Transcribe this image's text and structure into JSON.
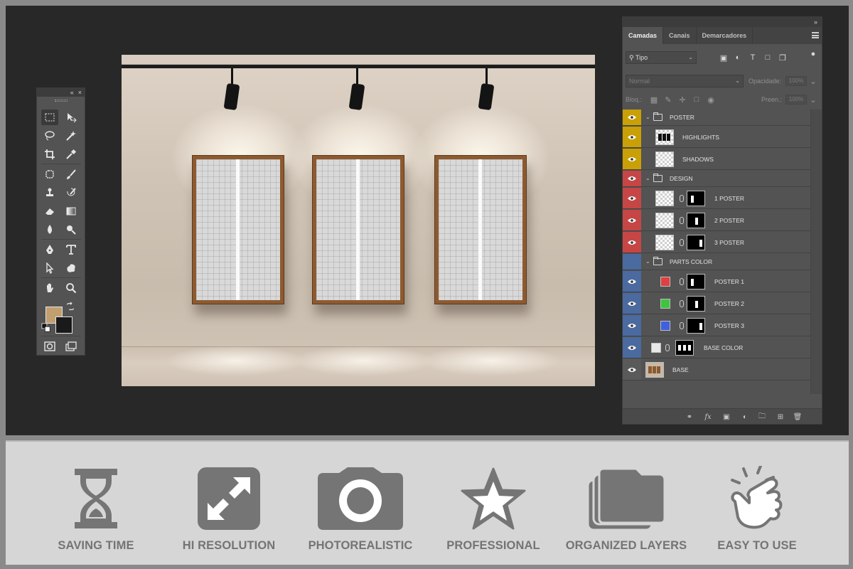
{
  "layers_panel": {
    "tabs": [
      {
        "label": "Camadas",
        "active": true
      },
      {
        "label": "Canais",
        "active": false
      },
      {
        "label": "Demarcadores",
        "active": false
      }
    ],
    "filter_label": "Tipo",
    "blend_mode": "Normal",
    "opacity_label": "Opacidade:",
    "opacity_value": "100%",
    "lock_label": "Bloq.:",
    "fill_label": "Preen.:",
    "fill_value": "100%",
    "layers": [
      {
        "name": "POSTER",
        "type": "group",
        "tag_color": "#c9a005"
      },
      {
        "name": "HIGHLIGHTS",
        "type": "layer",
        "tag_color": "#c9a005"
      },
      {
        "name": "SHADOWS",
        "type": "layer",
        "tag_color": "#c9a005"
      },
      {
        "name": "DESIGN",
        "type": "group",
        "tag_color": "#c64646"
      },
      {
        "name": "1 POSTER",
        "type": "smart",
        "tag_color": "#c64646"
      },
      {
        "name": "2 POSTER",
        "type": "smart",
        "tag_color": "#c64646"
      },
      {
        "name": "3 POSTER",
        "type": "smart",
        "tag_color": "#c64646"
      },
      {
        "name": "PARTS COLOR",
        "type": "group",
        "tag_color": "#4a6aa0"
      },
      {
        "name": "POSTER 1",
        "type": "fill",
        "tag_color": "#4a6aa0",
        "swatch": "#e04040"
      },
      {
        "name": "POSTER 2",
        "type": "fill",
        "tag_color": "#4a6aa0",
        "swatch": "#3fc43f"
      },
      {
        "name": "POSTER 3",
        "type": "fill",
        "tag_color": "#4a6aa0",
        "swatch": "#4060e0"
      },
      {
        "name": "BASE COLOR",
        "type": "fill",
        "tag_color": "#4a6aa0",
        "swatch": "#e8e8e8"
      },
      {
        "name": "BASE",
        "type": "image",
        "tag_color": "#5a5a5a"
      }
    ]
  },
  "toolbox": {
    "foreground_color": "#c29f6f",
    "background_color": "#1a1a1a"
  },
  "features": [
    {
      "label": "SAVING TIME",
      "icon": "hourglass-icon"
    },
    {
      "label": "HI RESOLUTION",
      "icon": "expand-arrows-icon"
    },
    {
      "label": "PHOTOREALISTIC",
      "icon": "camera-icon"
    },
    {
      "label": "PROFESSIONAL",
      "icon": "star-icon"
    },
    {
      "label": "ORGANIZED LAYERS",
      "icon": "layers-icon"
    },
    {
      "label": "EASY TO USE",
      "icon": "tap-hand-icon"
    }
  ],
  "colors": {
    "workspace_bg": "#282828",
    "panel_bg": "#535353",
    "banner_bg": "#d6d6d6",
    "feature_gray": "#757575"
  }
}
